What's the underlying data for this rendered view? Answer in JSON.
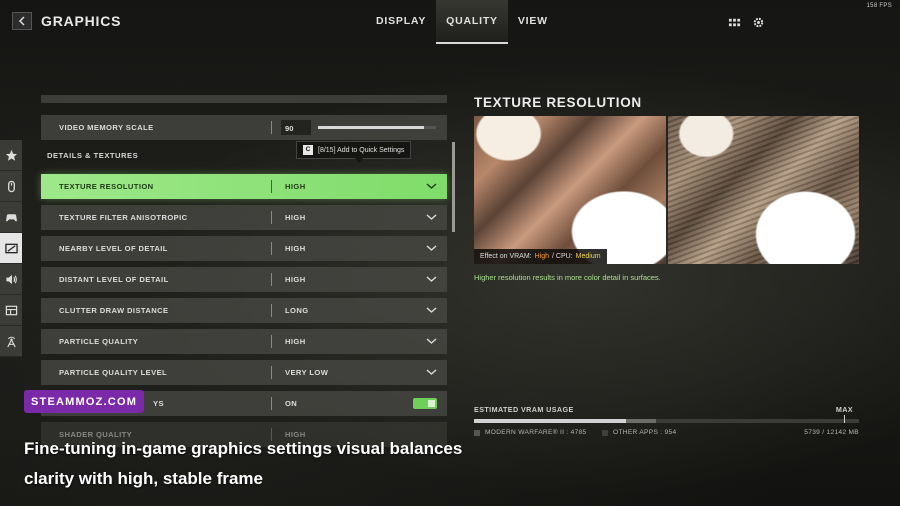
{
  "fps": "158 FPS",
  "header": {
    "title": "GRAPHICS",
    "tabs": [
      {
        "label": "DISPLAY",
        "active": false
      },
      {
        "label": "QUALITY",
        "active": true
      },
      {
        "label": "VIEW",
        "active": false
      }
    ],
    "icons": [
      "back-arrow-icon",
      "grid-icon",
      "gear-icon"
    ]
  },
  "rail": {
    "items": [
      {
        "icon": "star-icon",
        "active": false
      },
      {
        "icon": "mouse-icon",
        "active": false
      },
      {
        "icon": "controller-icon",
        "active": false
      },
      {
        "icon": "graphics-icon",
        "active": true
      },
      {
        "icon": "audio-icon",
        "active": false
      },
      {
        "icon": "interface-icon",
        "active": false
      },
      {
        "icon": "network-icon",
        "active": false
      }
    ]
  },
  "settings": {
    "video_memory_scale": {
      "label": "VIDEO MEMORY SCALE",
      "value": "90",
      "fraction": 0.9
    },
    "section": "DETAILS & TEXTURES",
    "quick_tip": {
      "key": "C",
      "text": "[8/15] Add to Quick Settings"
    },
    "rows": [
      {
        "label": "TEXTURE RESOLUTION",
        "value": "HIGH"
      },
      {
        "label": "TEXTURE FILTER ANISOTROPIC",
        "value": "HIGH"
      },
      {
        "label": "NEARBY LEVEL OF DETAIL",
        "value": "HIGH"
      },
      {
        "label": "DISTANT LEVEL OF DETAIL",
        "value": "HIGH"
      },
      {
        "label": "CLUTTER DRAW DISTANCE",
        "value": "LONG"
      },
      {
        "label": "PARTICLE QUALITY",
        "value": "HIGH"
      },
      {
        "label": "PARTICLE QUALITY LEVEL",
        "value": "VERY LOW"
      }
    ],
    "toggle_row": {
      "label": "YS",
      "value": "ON"
    },
    "shader_row": {
      "label": "SHADER QUALITY",
      "value": "HIGH"
    }
  },
  "detail": {
    "title": "TEXTURE RESOLUTION",
    "vram_prefix": "Effect on VRAM:",
    "vram_value": "High",
    "cpu_prefix": "/  CPU:",
    "cpu_value": "Medium",
    "description": "Higher resolution results in more color detail in surfaces."
  },
  "vram": {
    "title": "ESTIMATED VRAM USAGE",
    "max_label": "MAX",
    "mw_label": "MODERN WARFARE® II : 4785",
    "other_label": "OTHER APPS : 954",
    "total": "5739 / 12142 MB",
    "mw_fraction": 0.394,
    "other_fraction": 0.079,
    "colors": {
      "mw": "#d2d2d2",
      "other": "#6c6c68"
    }
  },
  "overlay": {
    "watermark": "STEAMMOZ.COM",
    "caption": "Fine-tuning in-game graphics settings visual balances clarity with high, stable frame"
  }
}
